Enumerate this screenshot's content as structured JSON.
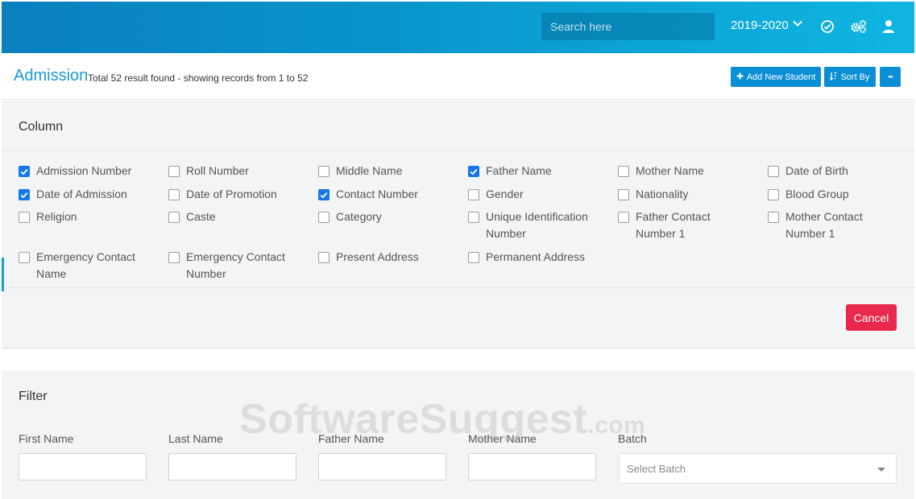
{
  "topbar": {
    "search_placeholder": "Search here",
    "year_label": "2019-2020",
    "icons": [
      "check-circle-icon",
      "gears-icon",
      "user-icon"
    ]
  },
  "header": {
    "title": "Admission",
    "subtitle": "Total 52 result found - showing records from 1 to 52",
    "add_label": "Add New Student",
    "sort_label": "Sort By",
    "more_label": "•••"
  },
  "column_panel": {
    "heading": "Column",
    "options": [
      {
        "label": "Admission Number",
        "checked": true
      },
      {
        "label": "Roll Number",
        "checked": false
      },
      {
        "label": "Middle Name",
        "checked": false
      },
      {
        "label": "Father Name",
        "checked": true
      },
      {
        "label": "Mother Name",
        "checked": false
      },
      {
        "label": "Date of Birth",
        "checked": false
      },
      {
        "label": "Date of Admission",
        "checked": true
      },
      {
        "label": "Date of Promotion",
        "checked": false
      },
      {
        "label": "Contact Number",
        "checked": true
      },
      {
        "label": "Gender",
        "checked": false
      },
      {
        "label": "Nationality",
        "checked": false
      },
      {
        "label": "Blood Group",
        "checked": false
      },
      {
        "label": "Religion",
        "checked": false
      },
      {
        "label": "Caste",
        "checked": false
      },
      {
        "label": "Category",
        "checked": false
      },
      {
        "label": "Unique Identification Number",
        "checked": false
      },
      {
        "label": "Father Contact Number 1",
        "checked": false
      },
      {
        "label": "Mother Contact Number 1",
        "checked": false
      },
      {
        "label": "Emergency Contact Name",
        "checked": false
      },
      {
        "label": "Emergency Contact Number",
        "checked": false
      },
      {
        "label": "Present Address",
        "checked": false
      },
      {
        "label": "Permanent Address",
        "checked": false
      }
    ],
    "cancel_label": "Cancel"
  },
  "filter_panel": {
    "heading": "Filter",
    "fields": [
      {
        "label": "First Name",
        "value": ""
      },
      {
        "label": "Last Name",
        "value": ""
      },
      {
        "label": "Father Name",
        "value": ""
      },
      {
        "label": "Mother Name",
        "value": ""
      }
    ],
    "batch_label": "Batch",
    "batch_placeholder": "Select Batch"
  },
  "watermark": {
    "main": "SoftwareSuggest",
    "suffix": ".com"
  },
  "colors": {
    "primary": "#0a8fd6",
    "title": "#1a9bd6",
    "cancel": "#e8294d",
    "checkbox": "#1677e8"
  }
}
